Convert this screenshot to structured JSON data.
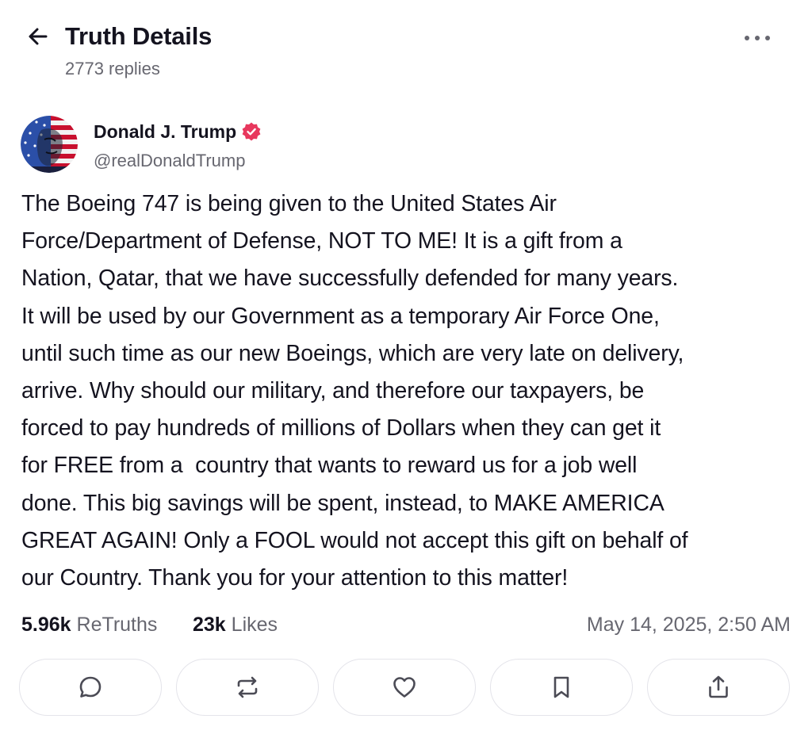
{
  "header": {
    "title": "Truth Details",
    "replies": "2773 replies",
    "back_icon": "arrow-left-icon",
    "more_icon": "more-horizontal-icon"
  },
  "author": {
    "name": "Donald J. Trump",
    "handle": "@realDonaldTrump",
    "verified": true,
    "verified_color": "#e8385e",
    "avatar_icon": "avatar-american-flag-portrait"
  },
  "post": {
    "text": "The Boeing 747 is being given to the United States Air\nForce/Department of Defense, NOT TO ME! It is a gift from a\nNation, Qatar, that we have successfully defended for many years.\nIt will be used by our Government as a temporary Air Force One,\nuntil such time as our new Boeings, which are very late on delivery,\narrive. Why should our military, and therefore our taxpayers, be\nforced to pay hundreds of millions of Dollars when they can get it\nfor FREE from a  country that wants to reward us for a job well\ndone. This big savings will be spent, instead, to MAKE AMERICA\nGREAT AGAIN! Only a FOOL would not accept this gift on behalf of\nour Country. Thank you for your attention to this matter!"
  },
  "stats": {
    "retruths_count": "5.96k",
    "retruths_label": "ReTruths",
    "likes_count": "23k",
    "likes_label": "Likes",
    "timestamp": "May 14, 2025, 2:50 AM"
  },
  "actions": [
    {
      "name": "reply",
      "icon": "comment-icon"
    },
    {
      "name": "retruth",
      "icon": "repost-icon"
    },
    {
      "name": "like",
      "icon": "heart-icon"
    },
    {
      "name": "bookmark",
      "icon": "bookmark-icon"
    },
    {
      "name": "share",
      "icon": "share-icon"
    }
  ],
  "colors": {
    "text_primary": "#14131f",
    "text_secondary": "#676770",
    "border": "#e4e4ea",
    "icon": "#4b4b55"
  }
}
